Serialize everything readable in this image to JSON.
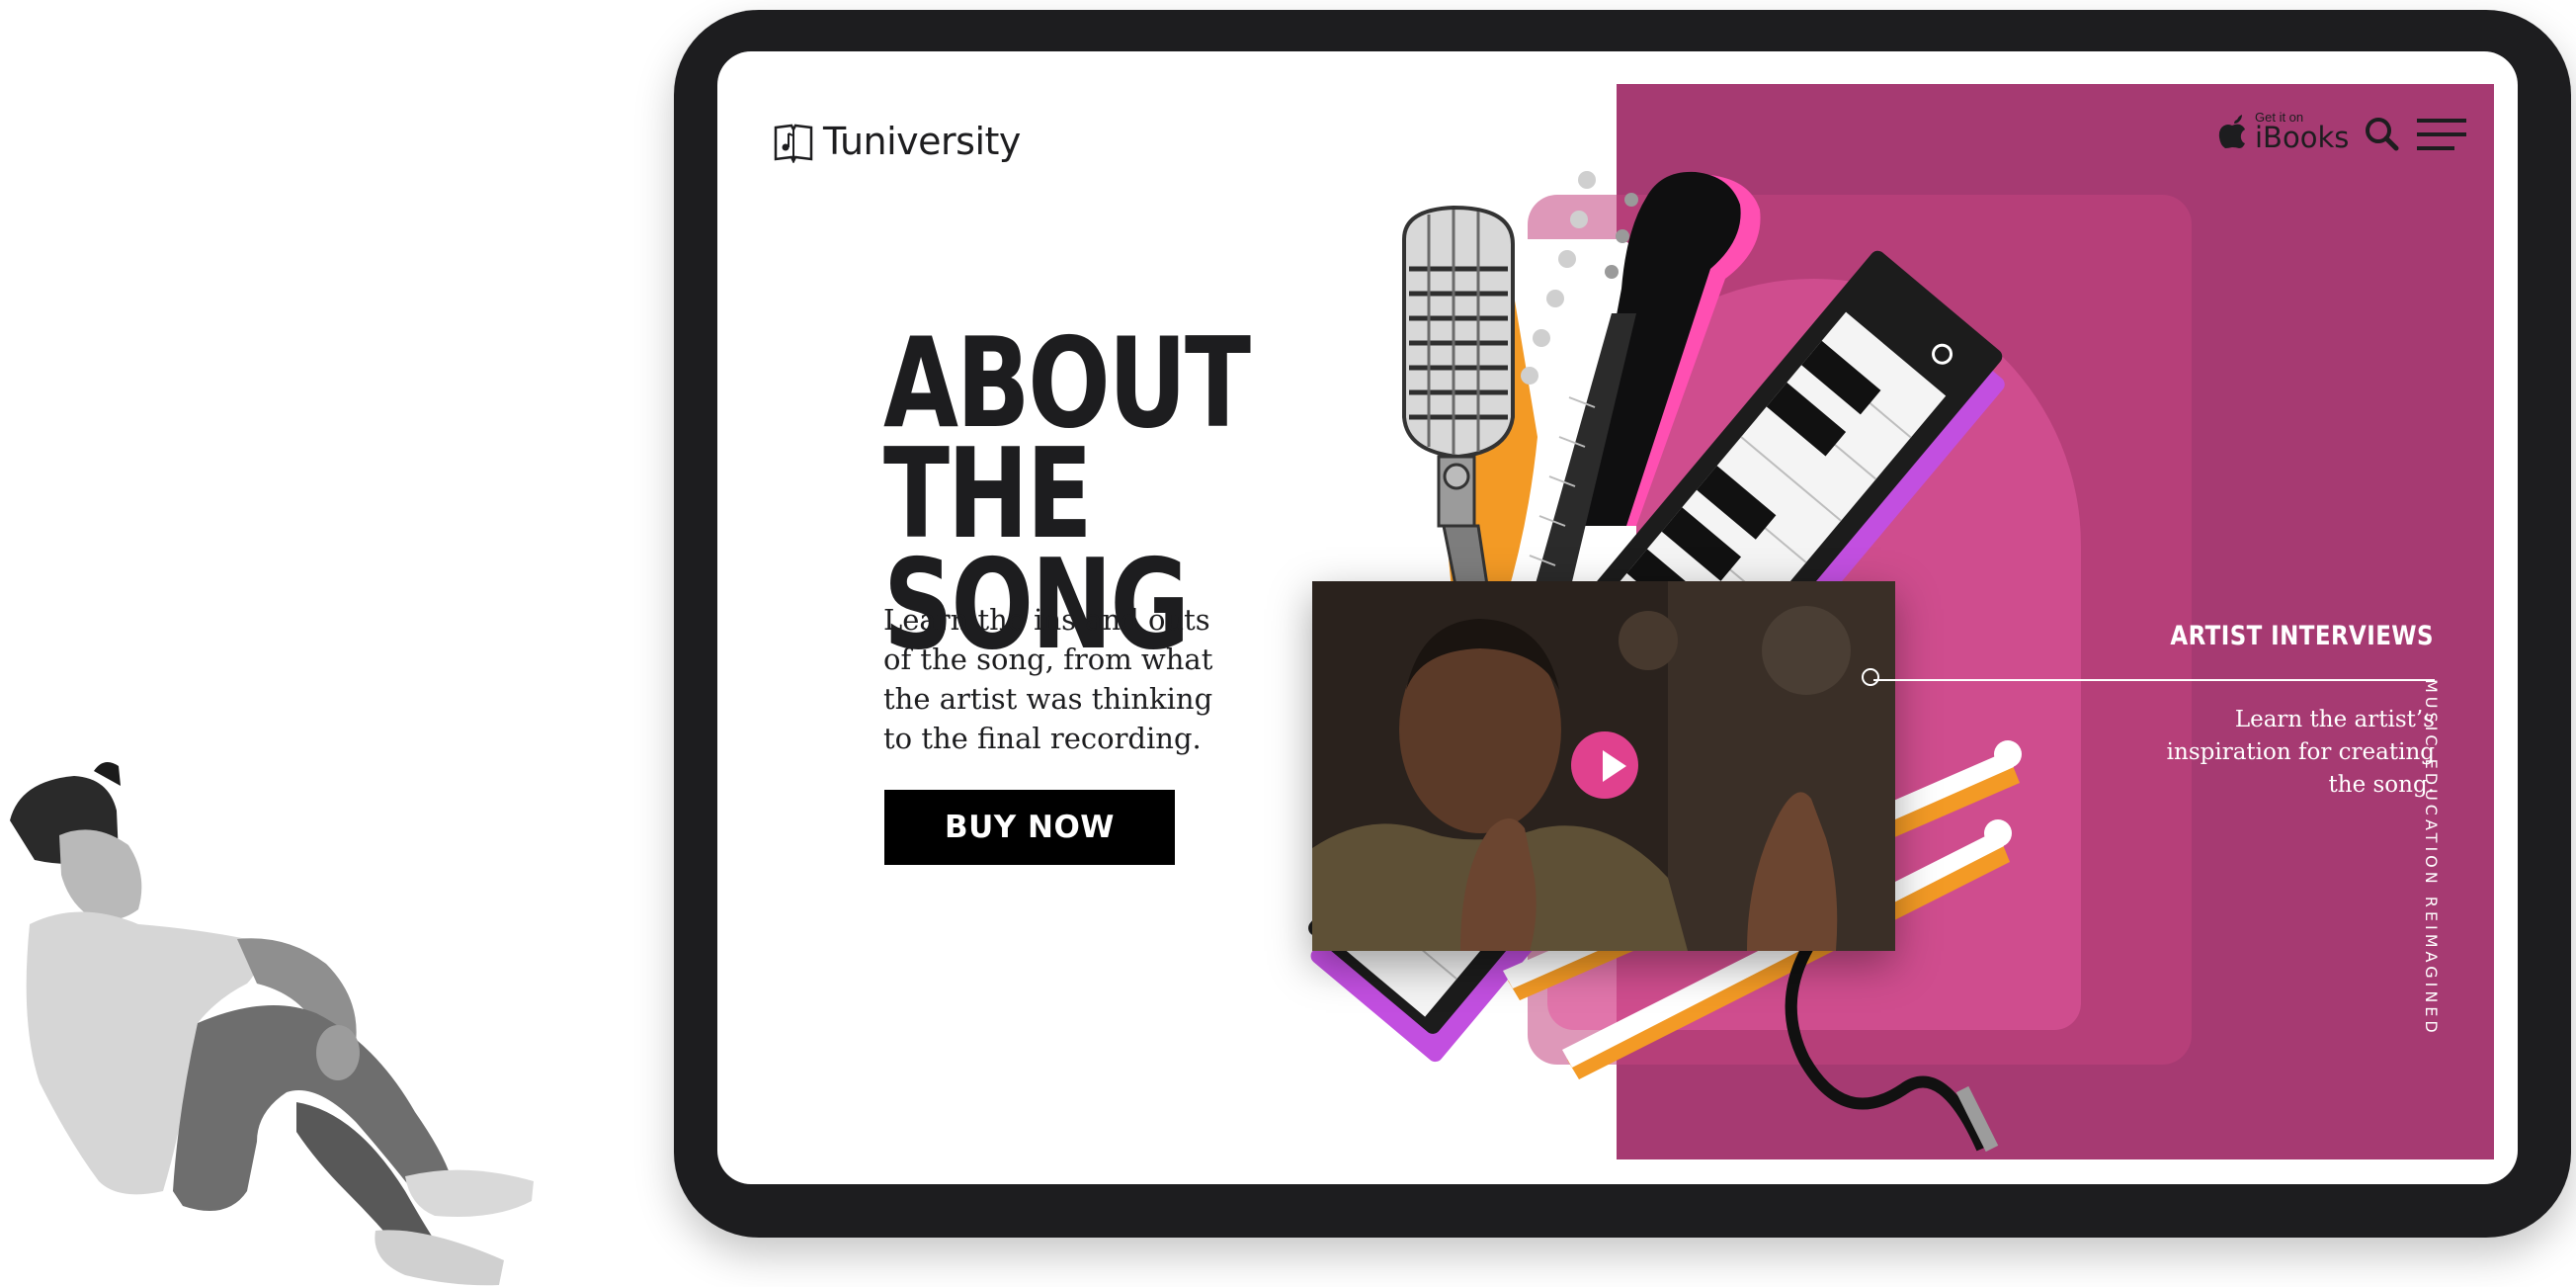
{
  "brand": {
    "name": "Tuniversity"
  },
  "store_badge": {
    "small": "Get it on",
    "big": "iBooks"
  },
  "hero": {
    "title_line1": "ABOUT",
    "title_line2": "THE SONG",
    "description": "Learn the ins and outs of the song, from what the artist was thinking to the final recording.",
    "cta_label": "BUY NOW"
  },
  "feature": {
    "title": "ARTIST INTERVIEWS",
    "description": "Learn the artist’s inspiration for creating the song."
  },
  "tagline": "MUSIC EDUCATION REIMAGINED",
  "colors": {
    "device": "#1d1d1f",
    "panel": "#a63a72",
    "accent_pink": "#e0418e",
    "accent_orange": "#f39a25",
    "accent_violet": "#c24fe0",
    "cta": "#000000"
  },
  "icons": [
    "apple-icon",
    "search-icon",
    "hamburger-menu-icon",
    "book-music-icon",
    "play-icon"
  ]
}
